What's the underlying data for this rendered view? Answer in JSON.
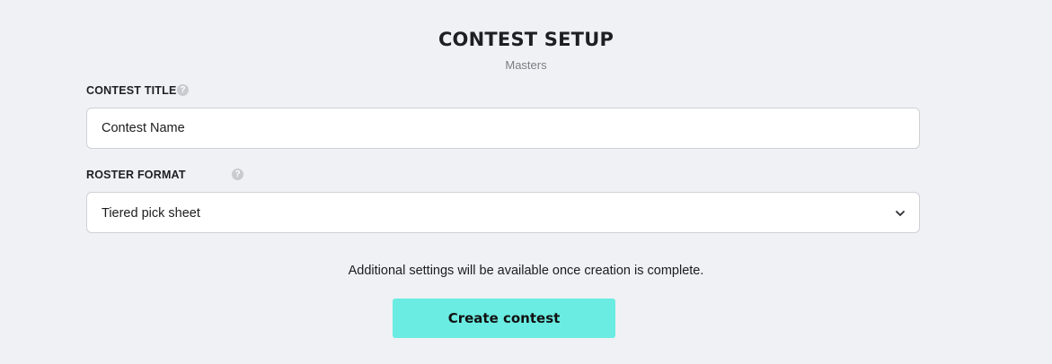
{
  "header": {
    "title": "CONTEST SETUP",
    "subtitle": "Masters"
  },
  "form": {
    "contest_title": {
      "label": "CONTEST TITLE",
      "help_icon": "question-circle-icon",
      "value": "Contest Name"
    },
    "roster_format": {
      "label": "ROSTER FORMAT",
      "help_icon": "question-circle-icon",
      "selected": "Tiered pick sheet",
      "dropdown_icon": "chevron-down-icon"
    },
    "note": "Additional settings will be available once creation is complete."
  },
  "actions": {
    "create_label": "Create contest"
  },
  "colors": {
    "background": "#f0f1f5",
    "accent": "#6aece2"
  }
}
